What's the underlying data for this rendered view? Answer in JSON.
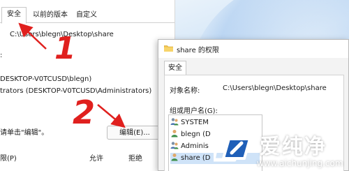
{
  "properties_window": {
    "tabs": [
      {
        "label": "安全"
      },
      {
        "label": "以前的版本"
      },
      {
        "label": "自定义"
      }
    ],
    "object_name": "C:\\Users\\blegn\\Desktop\\share",
    "object_label_fragment": ":",
    "groups": [
      {
        "text": "DESKTOP-V0TCUSD\\blegn)"
      },
      {
        "text": "trators (DESKTOP-V0TCUSD\\Administrators)"
      }
    ],
    "edit_hint": "请单击\"编辑\"。",
    "edit_button": "编辑(E)...",
    "permissions_header": {
      "name": "限(P)",
      "allow": "允许",
      "deny": "拒绝"
    }
  },
  "permissions_dialog": {
    "title": "share 的权限",
    "tab": "安全",
    "object_name_label": "对象名称:",
    "object_name_value": "C:\\Users\\blegn\\Desktop\\share",
    "group_label": "组或用户名(G):",
    "users": [
      {
        "name": "SYSTEM",
        "icon": "user-group-icon"
      },
      {
        "name": "blegn (D",
        "icon": "user-icon"
      },
      {
        "name": "Adminis",
        "icon": "user-group-icon"
      },
      {
        "name": "share (D",
        "icon": "user-icon"
      }
    ]
  },
  "annotations": {
    "step1": "1",
    "step2": "2",
    "color": "#e0201e"
  },
  "watermark": {
    "brand_cn": "爱纯净",
    "url": "www.aichunjing.com"
  }
}
